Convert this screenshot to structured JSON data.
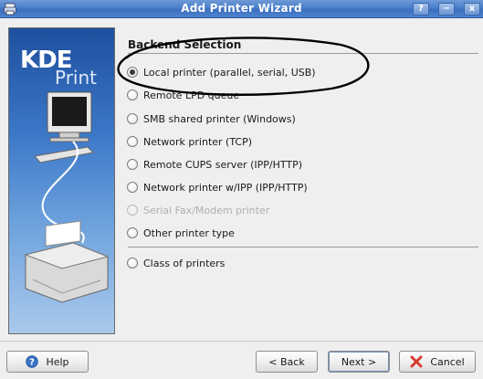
{
  "window": {
    "title": "Add Printer Wizard",
    "controls": [
      "?",
      "−",
      "x"
    ]
  },
  "side_panel": {
    "logo_main": "KDE",
    "logo_sub": "Print"
  },
  "main": {
    "section_title": "Backend Selection",
    "options": [
      {
        "label": "Local printer (parallel, serial, USB)",
        "checked": true,
        "disabled": false
      },
      {
        "label": "Remote LPD queue",
        "checked": false,
        "disabled": false
      },
      {
        "label": "SMB shared printer (Windows)",
        "checked": false,
        "disabled": false
      },
      {
        "label": "Network printer (TCP)",
        "checked": false,
        "disabled": false
      },
      {
        "label": "Remote CUPS server (IPP/HTTP)",
        "checked": false,
        "disabled": false
      },
      {
        "label": "Network printer w/IPP (IPP/HTTP)",
        "checked": false,
        "disabled": false
      },
      {
        "label": "Serial Fax/Modem printer",
        "checked": false,
        "disabled": true
      },
      {
        "label": "Other printer type",
        "checked": false,
        "disabled": false
      },
      {
        "label": "Class of printers",
        "checked": false,
        "disabled": false
      }
    ]
  },
  "buttons": {
    "help": "Help",
    "back": "< Back",
    "next": "Next >",
    "cancel": "Cancel"
  },
  "colors": {
    "titlebar": "#4a7fcc",
    "callout": "#000000",
    "cancel_icon": "#d83a2e",
    "help_icon": "#3a73c6"
  }
}
